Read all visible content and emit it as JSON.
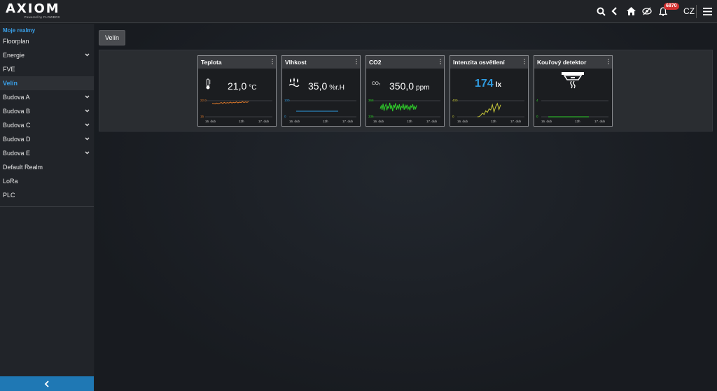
{
  "app": {
    "brand": "AXIOM",
    "powered_by": "Powered by FLOWBOX",
    "notifications_count": "6870",
    "language": "CZ"
  },
  "sidebar": {
    "heading": "Moje realmy",
    "items": [
      {
        "label": "Floorplan",
        "expandable": false,
        "active": false
      },
      {
        "label": "Energie",
        "expandable": true,
        "active": false
      },
      {
        "label": "FVE",
        "expandable": false,
        "active": false
      },
      {
        "label": "Velín",
        "expandable": false,
        "active": true
      },
      {
        "label": "Budova A",
        "expandable": true,
        "active": false
      },
      {
        "label": "Budova B",
        "expandable": true,
        "active": false
      },
      {
        "label": "Budova C",
        "expandable": true,
        "active": false
      },
      {
        "label": "Budova D",
        "expandable": true,
        "active": false
      },
      {
        "label": "Budova E",
        "expandable": true,
        "active": false
      },
      {
        "label": "Default Realm",
        "expandable": false,
        "active": false
      },
      {
        "label": "LoRa",
        "expandable": false,
        "active": false
      },
      {
        "label": "PLC",
        "expandable": false,
        "active": false
      }
    ]
  },
  "main": {
    "tab_label": "Velín"
  },
  "widgets": [
    {
      "title": "Teplota",
      "value": "21,0",
      "unit": "°C",
      "icon": "thermometer-icon",
      "color": "#e07a2a",
      "chart_data": {
        "type": "line",
        "ylim": [
          15,
          22.0
        ],
        "y_top_label": "22.0",
        "y_bottom_label": "15",
        "x_labels": [
          "16. dub",
          "12h",
          "17. dub"
        ],
        "values": [
          20.9,
          20.7,
          20.6,
          21.0,
          20.6,
          20.9,
          21.2,
          20.8,
          21.3,
          20.9,
          21.2,
          21.0,
          21.4,
          21.0,
          21.3,
          21.1,
          21.5,
          21.1,
          21.4,
          21.2,
          21.6,
          21.2,
          21.5,
          21.3,
          21.6
        ]
      }
    },
    {
      "title": "Vlhkost",
      "value": "35,0",
      "unit": "%r.H",
      "icon": "humidity-icon",
      "color": "#2f9be0",
      "chart_data": {
        "type": "line",
        "ylim": [
          0,
          100
        ],
        "y_top_label": "100",
        "y_bottom_label": "0",
        "x_labels": [
          "16. dub",
          "12h",
          "17. dub"
        ],
        "values": [
          35,
          35,
          35,
          35,
          35,
          35,
          35,
          35,
          35,
          35,
          35,
          35,
          35,
          35,
          35
        ]
      }
    },
    {
      "title": "CO2",
      "value": "350,0",
      "unit": "ppm",
      "icon": "co2-icon",
      "icon_text": "CO₂",
      "color": "#2fd12a",
      "chart_data": {
        "type": "line",
        "ylim": [
          336,
          368
        ],
        "y_top_label": "368",
        "y_bottom_label": "336",
        "x_labels": [
          "16. dub",
          "12h",
          "17. dub"
        ],
        "values": [
          352,
          358,
          350,
          362,
          348,
          356,
          361,
          349,
          357,
          353,
          364,
          351,
          359,
          347,
          360,
          355,
          363,
          350,
          358,
          352,
          361,
          349,
          357,
          354,
          362,
          350,
          359,
          353,
          360,
          351,
          356,
          349,
          358,
          354,
          361,
          350,
          357,
          352,
          359
        ]
      }
    },
    {
      "title": "Intenzita osvětlení",
      "value": "174",
      "unit": "lx",
      "icon": "",
      "color": "#c8c83a",
      "big": true,
      "chart_data": {
        "type": "line",
        "ylim": [
          0,
          400
        ],
        "y_top_label": "400",
        "y_bottom_label": "0",
        "x_labels": [
          "16. dub",
          "12h",
          "17. dub"
        ],
        "values": [
          null,
          null,
          null,
          null,
          null,
          null,
          null,
          null,
          0,
          5,
          40,
          90,
          60,
          150,
          110,
          200,
          170,
          300,
          120,
          250,
          330,
          180,
          300
        ]
      }
    },
    {
      "title": "Kouřový detektor",
      "value": "",
      "unit": "",
      "icon": "smoke-detector-icon",
      "color": "#2fd12a",
      "chart_data": {
        "type": "line",
        "ylim": [
          0,
          4
        ],
        "y_top_label": "4",
        "y_bottom_label": "0",
        "x_labels": [
          "16. dub",
          "12h",
          "17. dub"
        ],
        "values": [
          0,
          0,
          0,
          0,
          0,
          0,
          0,
          0,
          0,
          0,
          0,
          0,
          0
        ]
      }
    }
  ]
}
